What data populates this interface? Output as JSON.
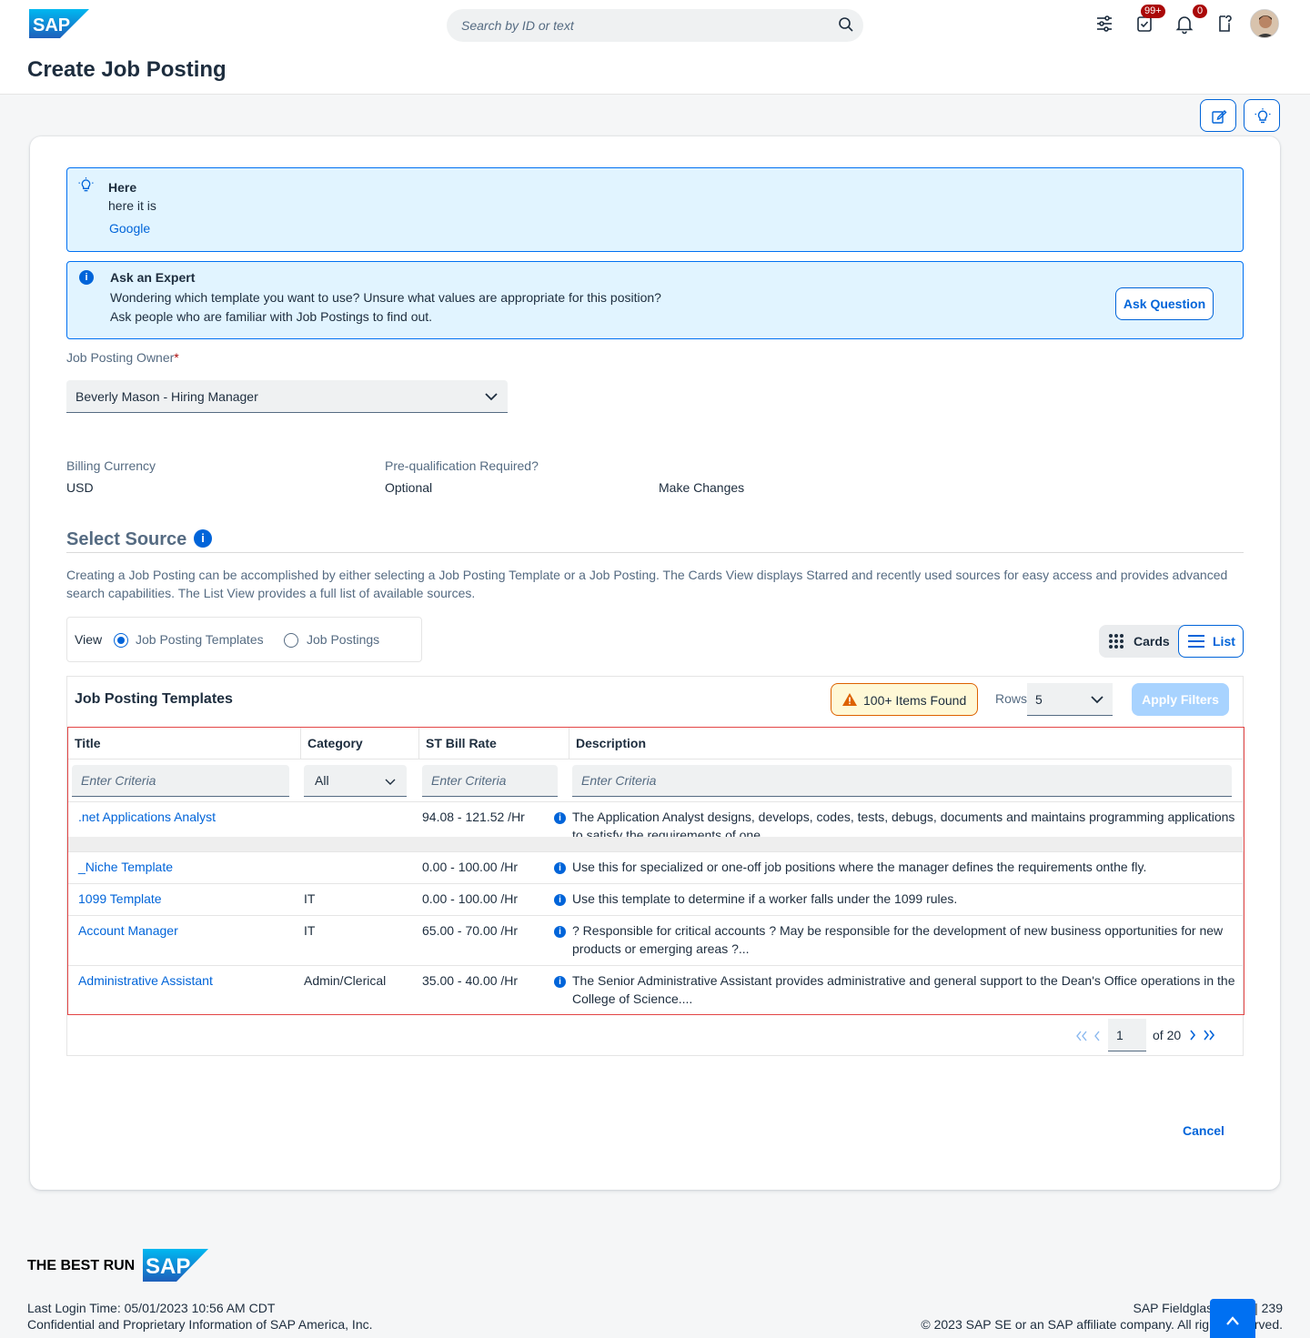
{
  "shell": {
    "search_placeholder": "Search by ID or text",
    "tasks_badge": "99+",
    "notifications_badge": "0",
    "logo_text": "SAP"
  },
  "page": {
    "title": "Create Job Posting"
  },
  "tip_message": {
    "title": "Here",
    "text": "here it is",
    "link": "Google"
  },
  "expert_message": {
    "title": "Ask an Expert",
    "line1": "Wondering which template you want to use? Unsure what values are appropriate for this position?",
    "line2": "Ask people who are familiar with Job Postings to find out.",
    "button": "Ask Question"
  },
  "owner": {
    "label": "Job Posting Owner",
    "required_mark": "*",
    "value": "Beverly Mason - Hiring Manager"
  },
  "billing": {
    "label": "Billing Currency",
    "value": "USD"
  },
  "prequal": {
    "label": "Pre-qualification Required?",
    "value": "Optional"
  },
  "make_changes": "Make Changes",
  "select_source": {
    "title": "Select Source",
    "description": "Creating a Job Posting can be accomplished by either selecting a Job Posting Template or a Job Posting. The Cards View displays Starred and recently used sources for easy access and provides advanced search capabilities. The List View provides a full list of available sources.",
    "view_label": "View",
    "option_templates": "Job Posting Templates",
    "option_postings": "Job Postings",
    "cards_label": "Cards",
    "list_label": "List"
  },
  "table": {
    "title": "Job Posting Templates",
    "items_found": "100+ Items Found",
    "rows_label": "Rows",
    "rows_value": "5",
    "apply_filters": "Apply Filters",
    "columns": [
      "Title",
      "Category",
      "ST Bill Rate",
      "Description"
    ],
    "filter_placeholder": "Enter Criteria",
    "category_filter_value": "All",
    "rows": [
      {
        "title": ".net Applications Analyst",
        "category": "",
        "rate": "94.08 - 121.52 /Hr",
        "description": "The Application Analyst designs, develops, codes, tests, debugs, documents and maintains programming applications to satisfy the requirements of one..."
      },
      {
        "title": "_Niche Template",
        "category": "",
        "rate": "0.00 - 100.00 /Hr",
        "description": "Use this for specialized or one-off job positions where the manager defines the requirements onthe fly."
      },
      {
        "title": "1099 Template",
        "category": "IT",
        "rate": "0.00 - 100.00 /Hr",
        "description": "Use this template to determine if a worker falls under the 1099 rules."
      },
      {
        "title": "Account Manager",
        "category": "IT",
        "rate": "65.00 - 70.00 /Hr",
        "description": "? Responsible for critical accounts ? May be responsible for the development of new business opportunities for new products or emerging areas ?..."
      },
      {
        "title": "Administrative Assistant",
        "category": "Admin/Clerical",
        "rate": "35.00 - 40.00 /Hr",
        "description": "The Senior Administrative Assistant provides administrative and general support to the Dean's Office operations in the College of Science...."
      }
    ],
    "pager": {
      "page": "1",
      "of_text": "of 20"
    }
  },
  "cancel": "Cancel",
  "footer": {
    "brand": "THE BEST RUN",
    "last_login": "Last Login Time: 05/01/2023 10:56 AM CDT",
    "confidential": "Confidential and Proprietary Information of SAP America, Inc.",
    "version": "SAP Fieldglass 2305 | 239",
    "copyright": "© 2023 SAP SE or an SAP affiliate company. All rights reserved."
  },
  "colors": {
    "accent": "#0064d9",
    "info_bg": "#e1f4ff",
    "warning": "#dd6100",
    "error_border": "#e34545"
  },
  "icons": [
    "search-icon",
    "settings-sliders-icon",
    "tasks-icon",
    "bell-icon",
    "help-icon",
    "edit-note-icon",
    "lightbulb-icon",
    "info-icon",
    "chevron-down-icon",
    "grid-icon",
    "list-icon",
    "warning-icon",
    "first-page-icon",
    "prev-page-icon",
    "next-page-icon",
    "last-page-icon",
    "scroll-top-icon"
  ]
}
